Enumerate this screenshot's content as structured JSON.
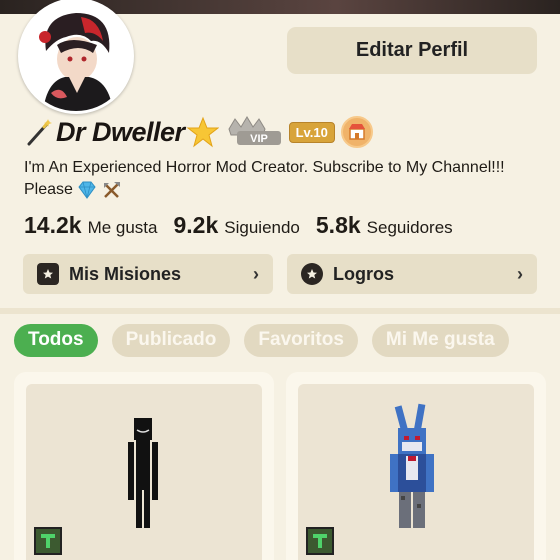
{
  "header": {
    "edit_profile_label": "Editar Perfil"
  },
  "profile": {
    "username": "Dr Dweller",
    "vip_label": "VIP",
    "level_label": "Lv.10",
    "bio": "I'm An Experienced Horror Mod Creator. Subscribe to My Channel!!! Please"
  },
  "stats": [
    {
      "value": "14.2k",
      "label": "Me gusta"
    },
    {
      "value": "9.2k",
      "label": "Siguiendo"
    },
    {
      "value": "5.8k",
      "label": "Seguidores"
    }
  ],
  "actions": {
    "missions_label": "Mis Misiones",
    "achievements_label": "Logros"
  },
  "tabs": [
    {
      "label": "Todos",
      "active": true
    },
    {
      "label": "Publicado",
      "active": false
    },
    {
      "label": "Favoritos",
      "active": false
    },
    {
      "label": "Mi Me gusta",
      "active": false
    }
  ],
  "colors": {
    "background": "#f6f1e3",
    "button_bg": "#e7dfc8",
    "active_tab": "#4caf50",
    "level_badge": "#d8a43a"
  },
  "icons": {
    "wand": "magic-wand-icon",
    "star": "star-icon",
    "vip": "crown-vip-icon",
    "shop": "shop-badge-icon",
    "missions": "calendar-star-icon",
    "achievements": "hexagon-star-icon",
    "chevron": "chevron-right-icon",
    "mod": "mod-tag-icon"
  }
}
